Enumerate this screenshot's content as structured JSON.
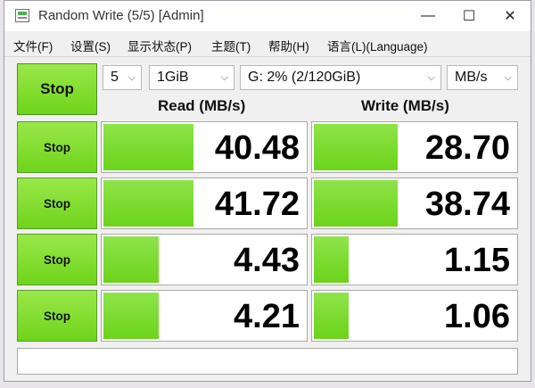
{
  "window": {
    "title": "Random Write (5/5) [Admin]",
    "icon": "app-window-icon",
    "controls": {
      "minimize": "—",
      "maximize": "☐",
      "close": "✕"
    }
  },
  "menu": [
    {
      "name": "menu-file",
      "label": "文件(F)"
    },
    {
      "name": "menu-settings",
      "label": "设置(S)"
    },
    {
      "name": "menu-display",
      "label": "显示状态(P)"
    },
    {
      "name": "menu-theme",
      "label": "主题(T)"
    },
    {
      "name": "menu-help",
      "label": "帮助(H)"
    },
    {
      "name": "menu-language",
      "label": "语言(L)(Language)"
    }
  ],
  "controls": {
    "main_button": "Stop",
    "count": "5",
    "size": "1GiB",
    "drive": "G: 2% (2/120GiB)",
    "unit": "MB/s"
  },
  "columns": {
    "read": "Read (MB/s)",
    "write": "Write (MB/s)"
  },
  "rows": [
    {
      "label": "Stop",
      "read": "40.48",
      "write": "28.70",
      "read_fill": 0.44,
      "write_fill": 0.41
    },
    {
      "label": "Stop",
      "read": "41.72",
      "write": "38.74",
      "read_fill": 0.44,
      "write_fill": 0.41
    },
    {
      "label": "Stop",
      "read": "4.43",
      "write": "1.15",
      "read_fill": 0.27,
      "write_fill": 0.17
    },
    {
      "label": "Stop",
      "read": "4.21",
      "write": "1.06",
      "read_fill": 0.27,
      "write_fill": 0.17
    }
  ],
  "status_text": "",
  "colors": {
    "accent_green": "#7ad626",
    "button_green": "#8fe43f"
  }
}
